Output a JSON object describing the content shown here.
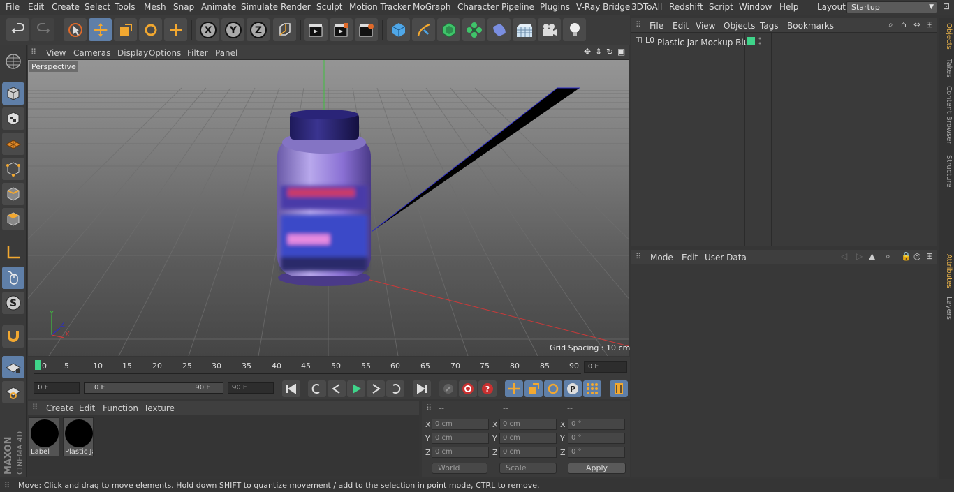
{
  "menubar": {
    "items": [
      "File",
      "Edit",
      "Create",
      "Select",
      "Tools",
      "Mesh",
      "Snap",
      "Animate",
      "Simulate",
      "Render",
      "Sculpt",
      "Motion Tracker",
      "MoGraph",
      "Character",
      "Pipeline",
      "Plugins",
      "V-Ray Bridge",
      "3DToAll",
      "Redshift",
      "Script",
      "Window",
      "Help"
    ],
    "layout_label": "Layout:",
    "layout_value": "Startup"
  },
  "toolbar": {
    "icons": [
      "undo-icon",
      "redo-icon",
      "live-selection-icon",
      "move-icon",
      "scale-icon",
      "rotate-icon",
      "add-icon",
      "x-axis-icon",
      "y-axis-icon",
      "z-axis-icon",
      "coordinate-system-icon",
      "render-view-icon",
      "render-picture-viewer-icon",
      "edit-render-settings-icon",
      "cube-icon",
      "pen-icon",
      "subdivision-icon",
      "cloner-icon",
      "deformer-icon",
      "floor-icon",
      "camera-icon",
      "light-icon"
    ]
  },
  "viewport": {
    "menu": [
      "View",
      "Cameras",
      "Display",
      "Options",
      "Filter",
      "Panel"
    ],
    "label": "Perspective",
    "grid_spacing": "Grid Spacing : 10 cm",
    "axes": {
      "x": "X",
      "y": "Y",
      "z": "Z"
    }
  },
  "timeline": {
    "ticks": [
      "0",
      "5",
      "10",
      "15",
      "20",
      "25",
      "30",
      "35",
      "40",
      "45",
      "50",
      "55",
      "60",
      "65",
      "70",
      "75",
      "80",
      "85",
      "90"
    ],
    "current_frame": "0 F",
    "start_field": "0 F",
    "range_start": "0 F",
    "range_end": "90 F",
    "end_field": "90 F"
  },
  "materials": {
    "menu": [
      "Create",
      "Edit",
      "Function",
      "Texture"
    ],
    "items": [
      {
        "name": "Label"
      },
      {
        "name": "Plastic Ja"
      }
    ]
  },
  "coords": {
    "headers": [
      "--",
      "--",
      "--"
    ],
    "rows": [
      {
        "axis": "X",
        "pos": "0 cm",
        "size": "0 cm",
        "rot": "0 °"
      },
      {
        "axis": "Y",
        "pos": "0 cm",
        "size": "0 cm",
        "rot": "0 °"
      },
      {
        "axis": "Z",
        "pos": "0 cm",
        "size": "0 cm",
        "rot": "0 °"
      }
    ],
    "mode": "World",
    "scale": "Scale",
    "apply": "Apply"
  },
  "objects": {
    "menu": [
      "File",
      "Edit",
      "View",
      "Objects",
      "Tags",
      "Bookmarks"
    ],
    "items": [
      {
        "name": "Plastic Jar Mockup Blue",
        "color": "#3fd48a"
      }
    ]
  },
  "attributes": {
    "menu": [
      "Mode",
      "Edit",
      "User Data"
    ]
  },
  "right_tabs": [
    "Objects",
    "Takes",
    "Content Browser",
    "Structure",
    "Attributes",
    "Layers"
  ],
  "brand": {
    "line1": "MAXON",
    "line2": "CINEMA 4D"
  },
  "status": "Move: Click and drag to move elements. Hold down SHIFT to quantize movement / add to the selection in point mode, CTRL to remove.",
  "colors": {
    "accent": "#5f7fa8",
    "active_tab": "#e8b24a"
  }
}
